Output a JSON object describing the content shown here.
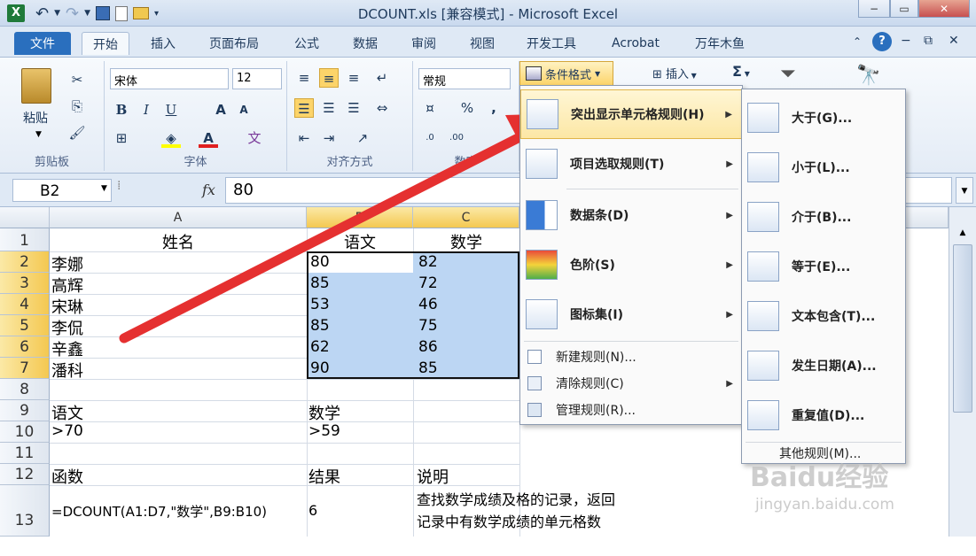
{
  "window": {
    "title": "DCOUNT.xls  [兼容模式] - Microsoft Excel",
    "min": "−",
    "max": "▭",
    "close": "✕"
  },
  "qat": {
    "undo": "↶",
    "redo": "↷",
    "save": "💾"
  },
  "tabs": [
    "文件",
    "开始",
    "插入",
    "页面布局",
    "公式",
    "数据",
    "审阅",
    "视图",
    "开发工具",
    "Acrobat",
    "万年木鱼"
  ],
  "ribbon": {
    "paste": "粘贴",
    "clipboard_label": "剪贴板",
    "font_name": "宋体",
    "font_size": "12",
    "font_label": "字体",
    "align_label": "对齐方式",
    "number_format": "常规",
    "number_label": "数字",
    "cond_format": "条件格式",
    "insert": "插入",
    "sigma": "Σ",
    "bold": "B",
    "italic": "I",
    "underline": "U",
    "percent": "%",
    "comma": ","
  },
  "formula_bar": {
    "name_box": "B2",
    "fx": "fx",
    "value": "80"
  },
  "columns": [
    "A",
    "B",
    "C"
  ],
  "rows": [
    {
      "n": "1",
      "a": "姓名",
      "b": "语文",
      "c": "数学"
    },
    {
      "n": "2",
      "a": "李娜",
      "b": "80",
      "c": "82"
    },
    {
      "n": "3",
      "a": "高辉",
      "b": "85",
      "c": "72"
    },
    {
      "n": "4",
      "a": "宋琳",
      "b": "53",
      "c": "46"
    },
    {
      "n": "5",
      "a": "李侃",
      "b": "85",
      "c": "75"
    },
    {
      "n": "6",
      "a": "辛鑫",
      "b": "62",
      "c": "86"
    },
    {
      "n": "7",
      "a": "潘科",
      "b": "90",
      "c": "85"
    },
    {
      "n": "8",
      "a": "",
      "b": "",
      "c": ""
    },
    {
      "n": "9",
      "a": "语文",
      "b": "数学",
      "c": ""
    },
    {
      "n": "10",
      "a": ">70",
      "b": ">59",
      "c": ""
    },
    {
      "n": "11",
      "a": "",
      "b": "",
      "c": ""
    },
    {
      "n": "12",
      "a": "函数",
      "b": "结果",
      "c": "说明"
    },
    {
      "n": "13",
      "a": "=DCOUNT(A1:D7,\"数学\",B9:B10)",
      "b": "6",
      "c": "查找数学成绩及格的记录，返回",
      "c2": "记录中有数学成绩的单元格数"
    }
  ],
  "menu1": {
    "items": [
      "突出显示单元格规则(H)",
      "项目选取规则(T)",
      "数据条(D)",
      "色阶(S)",
      "图标集(I)"
    ],
    "small_items": [
      "新建规则(N)...",
      "清除规则(C)",
      "管理规则(R)..."
    ]
  },
  "menu2": {
    "items": [
      "大于(G)...",
      "小于(L)...",
      "介于(B)...",
      "等于(E)...",
      "文本包含(T)...",
      "发生日期(A)...",
      "重复值(D)..."
    ],
    "more": "其他规则(M)..."
  },
  "watermark": {
    "brand": "Baidu经验",
    "url": "jingyan.baidu.com"
  },
  "colors": {
    "selection": "#bcd6f3",
    "menu_highlight": "#fce7a5",
    "arrow": "#e53030",
    "file_tab": "#2a6fbe"
  }
}
